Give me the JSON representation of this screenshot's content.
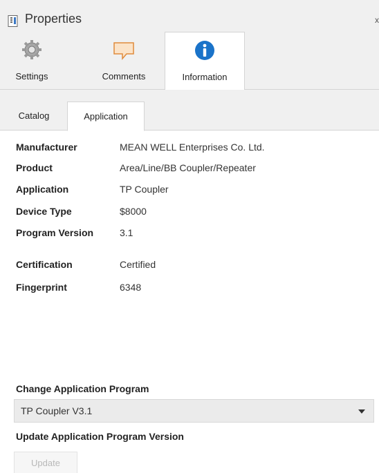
{
  "window": {
    "title": "Properties",
    "close_glyph": "x",
    "title_icon": "properties-icon"
  },
  "top_tabs": [
    {
      "label": "Settings",
      "icon": "gear-icon"
    },
    {
      "label": "Comments",
      "icon": "comment-icon"
    },
    {
      "label": "Information",
      "icon": "info-icon",
      "active": true
    }
  ],
  "sub_tabs": [
    {
      "label": "Catalog"
    },
    {
      "label": "Application",
      "active": true
    }
  ],
  "details": [
    {
      "key": "Manufacturer",
      "value": "MEAN WELL Enterprises Co. Ltd."
    },
    {
      "key": "Product",
      "value": "Area/Line/BB Coupler/Repeater"
    },
    {
      "key": "Application",
      "value": "TP Coupler"
    },
    {
      "key": "Device Type",
      "value": "$8000"
    },
    {
      "key": "Program Version",
      "value": "3.1"
    },
    {
      "key": "Certification",
      "value": "Certified"
    },
    {
      "key": "Fingerprint",
      "value": "6348"
    }
  ],
  "change_program": {
    "label": "Change Application Program",
    "selected": "TP Coupler V3.1"
  },
  "update_version": {
    "label": "Update Application Program Version",
    "button_label": "Update"
  },
  "colors": {
    "info_blue": "#1a73c9",
    "comment_orange": "#f0c08a"
  }
}
